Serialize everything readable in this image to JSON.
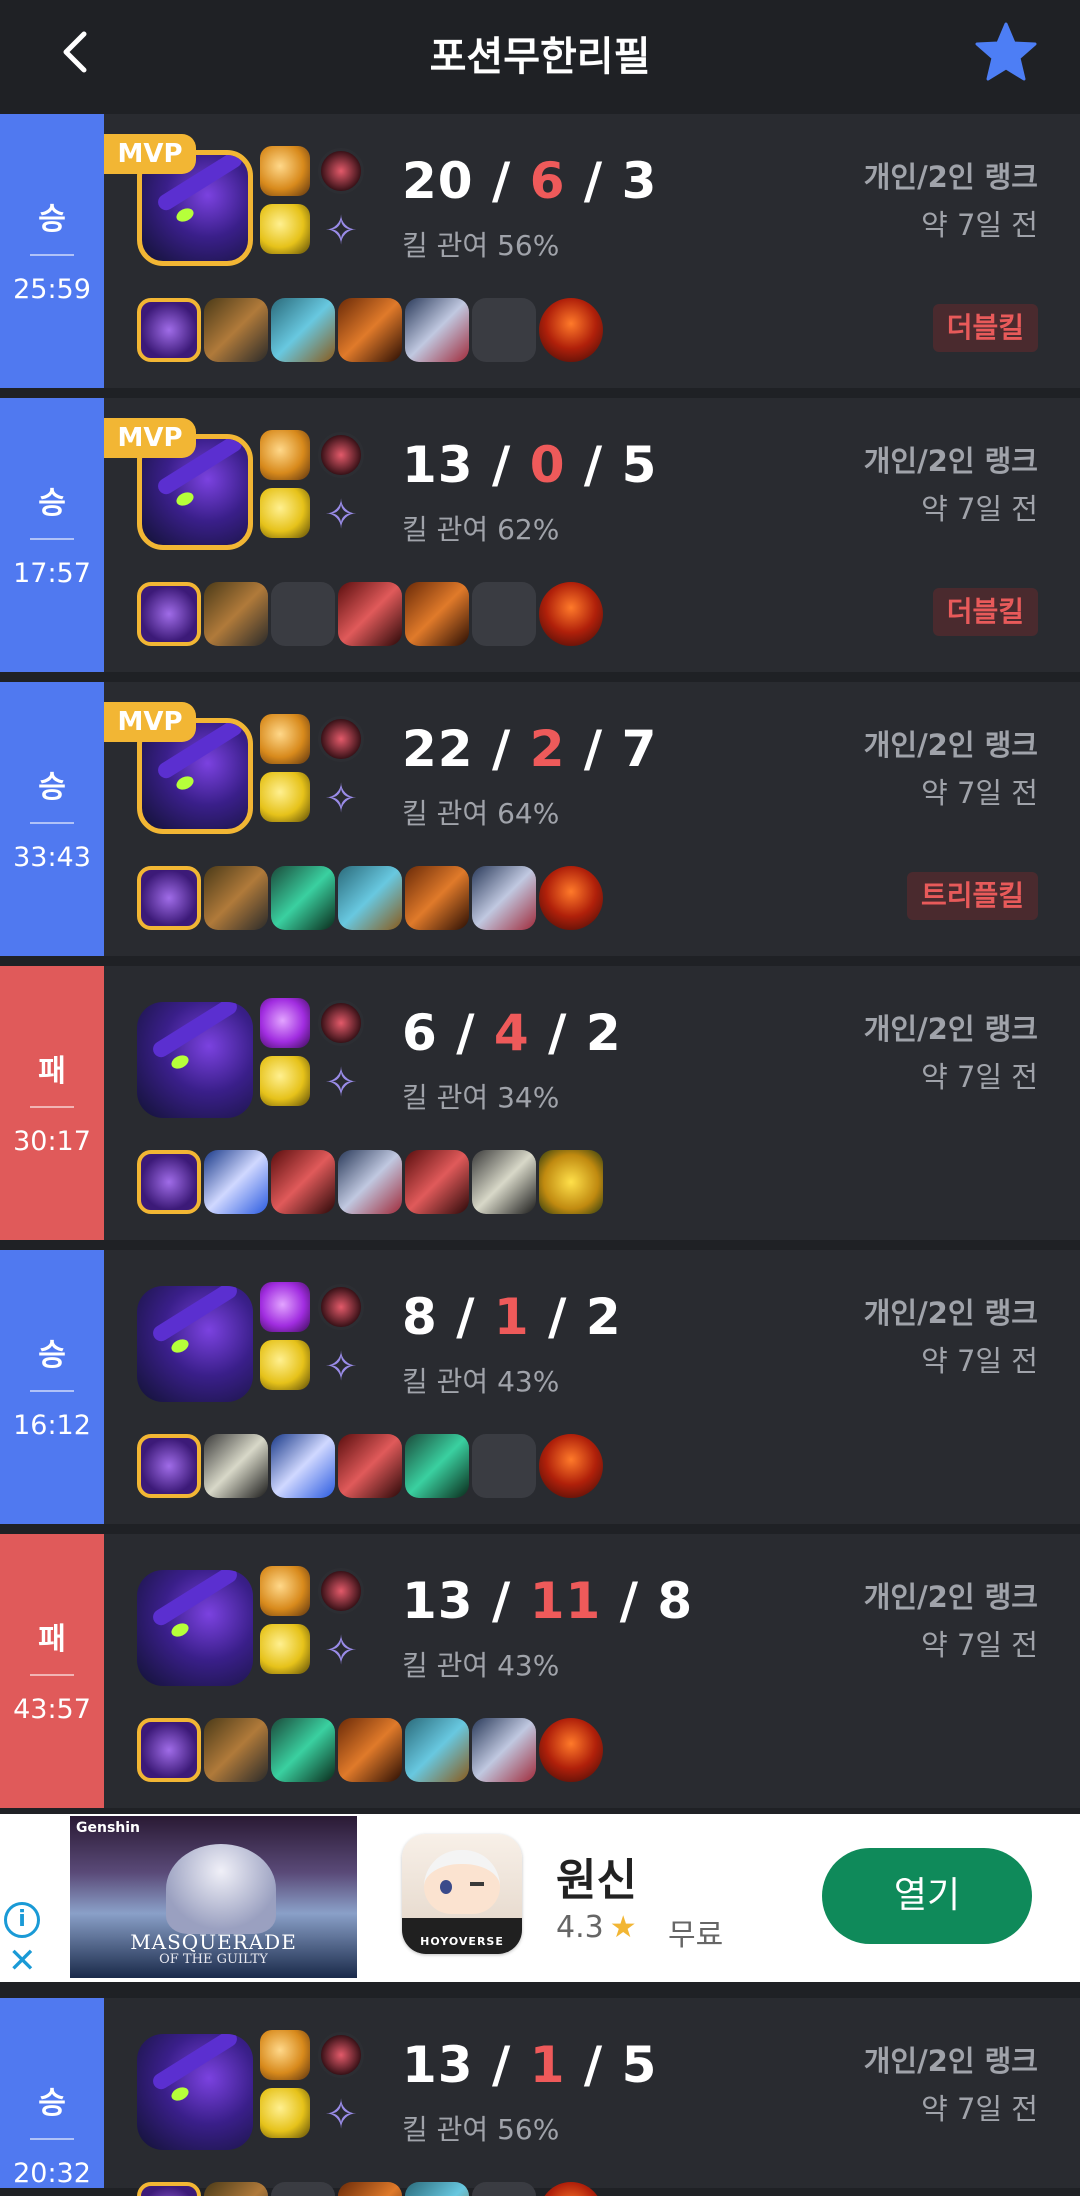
{
  "header": {
    "title": "포션무한리필",
    "back_icon": "back-chevron-icon",
    "favorite_icon": "star-icon",
    "favorite_color": "#4d7ef5"
  },
  "colors": {
    "win": "#5079f0",
    "loss": "#e05a5a",
    "mvp": "#f2b634",
    "deaths": "#ee5a5a"
  },
  "matches": [
    {
      "result": "승",
      "duration": "25:59",
      "mvp": "MVP",
      "kills": "20",
      "deaths": "6",
      "assists": "3",
      "sep": "/",
      "kill_participation": "킬 관여 56%",
      "queue": "개인/2인 랭크",
      "time_ago": "약 7일 전",
      "multikill": "더블킬"
    },
    {
      "result": "승",
      "duration": "17:57",
      "mvp": "MVP",
      "kills": "13",
      "deaths": "0",
      "assists": "5",
      "sep": "/",
      "kill_participation": "킬 관여 62%",
      "queue": "개인/2인 랭크",
      "time_ago": "약 7일 전",
      "multikill": "더블킬"
    },
    {
      "result": "승",
      "duration": "33:43",
      "mvp": "MVP",
      "kills": "22",
      "deaths": "2",
      "assists": "7",
      "sep": "/",
      "kill_participation": "킬 관여 64%",
      "queue": "개인/2인 랭크",
      "time_ago": "약 7일 전",
      "multikill": "트리플킬"
    },
    {
      "result": "패",
      "duration": "30:17",
      "kills": "6",
      "deaths": "4",
      "assists": "2",
      "sep": "/",
      "kill_participation": "킬 관여 34%",
      "queue": "개인/2인 랭크",
      "time_ago": "약 7일 전"
    },
    {
      "result": "승",
      "duration": "16:12",
      "kills": "8",
      "deaths": "1",
      "assists": "2",
      "sep": "/",
      "kill_participation": "킬 관여 43%",
      "queue": "개인/2인 랭크",
      "time_ago": "약 7일 전"
    },
    {
      "result": "패",
      "duration": "43:57",
      "kills": "13",
      "deaths": "11",
      "assists": "8",
      "sep": "/",
      "kill_participation": "킬 관여 43%",
      "queue": "개인/2인 랭크",
      "time_ago": "약 7일 전"
    },
    {
      "result": "승",
      "duration": "20:32",
      "kills": "13",
      "deaths": "1",
      "assists": "5",
      "sep": "/",
      "kill_participation": "킬 관여 56%",
      "queue": "개인/2인 랭크",
      "time_ago": "약 7일 전"
    }
  ],
  "ad": {
    "banner_logo": "Genshin",
    "banner_caption": "MASQUERADE",
    "banner_caption2": "OF THE GUILTY",
    "app_icon_brand": "HOYOVERSE",
    "app_name": "원신",
    "rating": "4.3",
    "rating_star": "★",
    "price": "무료",
    "cta": "열기",
    "info_icon": "info-icon",
    "close_icon": "close-icon"
  }
}
